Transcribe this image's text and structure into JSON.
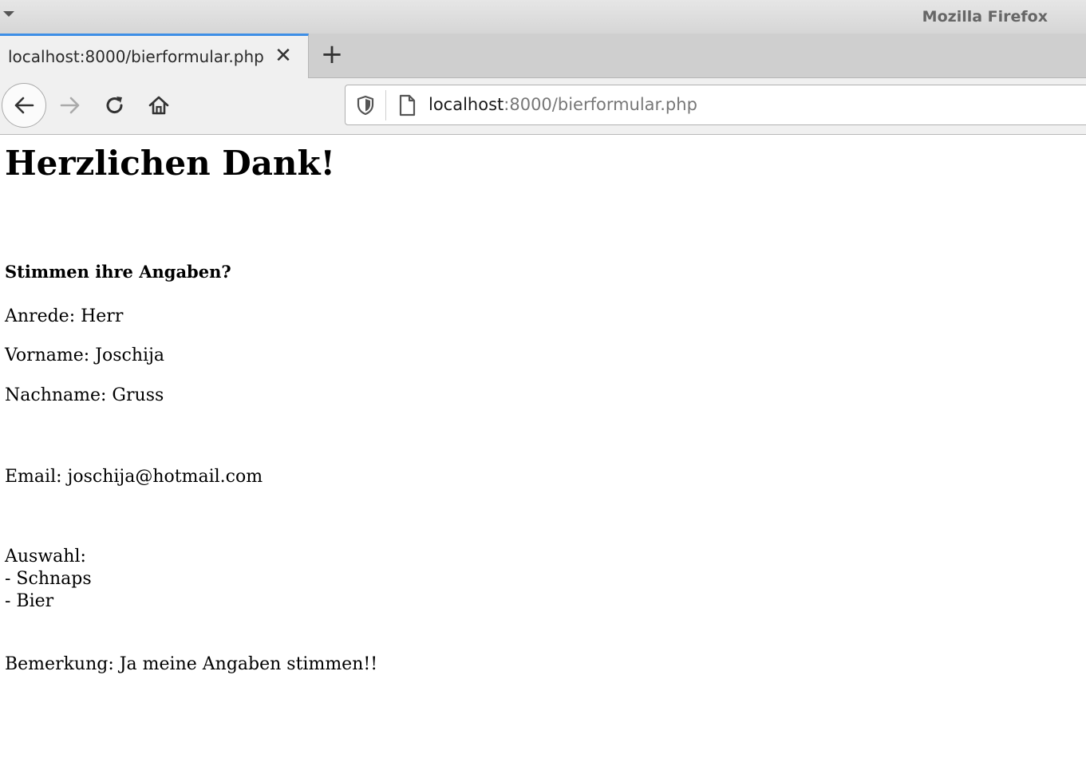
{
  "window": {
    "title": "Mozilla Firefox"
  },
  "tab": {
    "title": "localhost:8000/bierformular.php",
    "close_glyph": "✕"
  },
  "new_tab_glyph": "+",
  "address_bar": {
    "host": "localhost",
    "rest": ":8000/bierformular.php"
  },
  "icons": [
    "menu-arrow-icon",
    "back-arrow-icon",
    "forward-arrow-icon",
    "reload-icon",
    "home-icon",
    "shield-icon",
    "page-icon",
    "close-icon",
    "plus-icon"
  ],
  "page": {
    "heading": "Herzlichen Dank!",
    "subheading": "Stimmen ihre Angaben?",
    "anrede": "Anrede: Herr",
    "vorname": "Vorname: Joschija",
    "nachname": "Nachname: Gruss",
    "email": "Email: joschija@hotmail.com",
    "auswahl_label": "Auswahl:",
    "auswahl_items": [
      "- Schnaps",
      "- Bier"
    ],
    "bemerkung": "Bemerkung: Ja meine Angaben stimmen!!"
  },
  "colors": {
    "active_tab_accent": "#3d8ee6"
  }
}
